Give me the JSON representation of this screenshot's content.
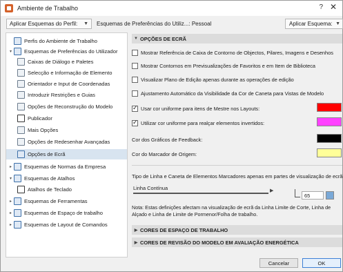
{
  "window": {
    "title": "Ambiente de Trabalho",
    "help": "?",
    "close": "✕"
  },
  "topbar": {
    "apply_profile": "Aplicar Esquemas do Perfil:",
    "profile_text": "Esquemas de Preferências do Utiliz...: Pessoal",
    "apply_scheme": "Aplicar Esquema:"
  },
  "sidebar": {
    "items": [
      {
        "label": "Perfis do Ambiente de Trabalho",
        "expander": "",
        "icon": "profile-icon"
      },
      {
        "label": "Esquemas de Preferências do Utilizador",
        "expander": "▾",
        "icon": "user-prefs-icon"
      },
      {
        "label": "Caixas de Diálogo e Paletes",
        "expander": "",
        "icon": "dialog-icon"
      },
      {
        "label": "Selecção e Informação de Elemento",
        "expander": "",
        "icon": "selection-icon"
      },
      {
        "label": "Orientador e Input de Coordenadas",
        "expander": "",
        "icon": "tracker-icon"
      },
      {
        "label": "Introduzir Restrições e Guias",
        "expander": "",
        "icon": "guides-icon"
      },
      {
        "label": "Opções de Reconstrução do Modelo",
        "expander": "",
        "icon": "rebuild-icon"
      },
      {
        "label": "Publicador",
        "expander": "",
        "icon": "publisher-icon"
      },
      {
        "label": "Mais Opções",
        "expander": "",
        "icon": "more-options-icon"
      },
      {
        "label": "Opções de Redesenhar Avançadas",
        "expander": "",
        "icon": "redraw-icon"
      },
      {
        "label": "Opções de Ecrã",
        "expander": "",
        "icon": "screen-icon"
      },
      {
        "label": "Esquemas de Normas da Empresa",
        "expander": "▸",
        "icon": "company-icon"
      },
      {
        "label": "Esquemas de Atalhos",
        "expander": "▾",
        "icon": "shortcuts-icon"
      },
      {
        "label": "Atalhos de Teclado",
        "expander": "",
        "icon": "keyboard-icon"
      },
      {
        "label": "Esquemas de Ferramentas",
        "expander": "▸",
        "icon": "tools-icon"
      },
      {
        "label": "Esquemas de Espaço de trabalho",
        "expander": "▸",
        "icon": "workspace-icon"
      },
      {
        "label": "Esquemas de Layout de Comandos",
        "expander": "▸",
        "icon": "command-layout-icon"
      }
    ]
  },
  "content": {
    "section_title": "OPÇÕES DE ECRÃ",
    "checks": [
      {
        "label": "Mostrar Referência de Caixa de Contorno de Objectos, Pilares, Imagens e Desenhos",
        "checked": false
      },
      {
        "label": "Mostrar Contornos em Previsualizações de Favoritos e em Item de Biblioteca",
        "checked": false
      },
      {
        "label": "Visualizar Plano de Edição apenas durante as operações de edição",
        "checked": false
      },
      {
        "label": "Ajustamento Automático da Visibilidade da Cor de Caneta para Vistas de Modelo",
        "checked": false
      },
      {
        "label": "Usar cor uniforme para itens de Mestre nos Layouts:",
        "checked": true
      },
      {
        "label": "Utilizar cor uniforme para realçar elementos invertidos:",
        "checked": true
      }
    ],
    "feedback_label": "Cor dos Gráficos de Feedback:",
    "marker_label": "Cor do Marcador de Origem:",
    "swatch_colors": [
      "#ff0000",
      "#ff40ff",
      "#000000",
      "#ffff99"
    ],
    "marker_line_label": "Tipo de Linha e Caneta de Elementos Marcadores apenas em partes de visualização de ecrã:",
    "linetype_value": "Linha Contínua",
    "pen_number": "65",
    "note": "Nota: Estas definições afectam na visualização de ecrã da Linha Limite de Corte, Linha de Alçado e Linha de Limite de Pormenor/Folha de trabalho.",
    "collapsed_sections": [
      "CORES DE ESPAÇO DE TRABALHO",
      "CORES DE REVISÃO DO MODELO EM AVALIAÇÃO ENERGÉTICA"
    ]
  },
  "buttons": {
    "cancel": "Cancelar",
    "ok": "OK"
  }
}
